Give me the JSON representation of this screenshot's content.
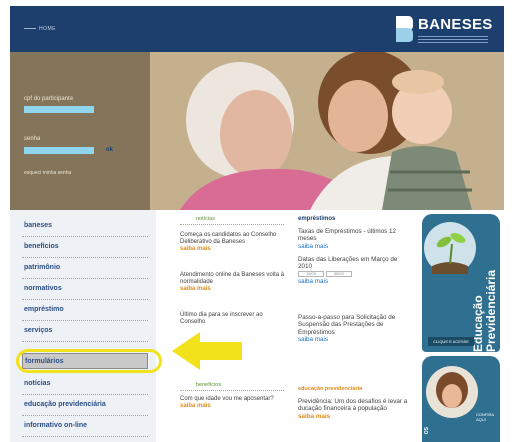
{
  "header": {
    "home_link": "HOME",
    "logo_text": "BANESES"
  },
  "login": {
    "cpf_label": "cpf do participante",
    "password_label": "senha",
    "ok_label": "ok",
    "forgot_label": "esqueci minha senha"
  },
  "nav": {
    "items": [
      "baneses",
      "benefícios",
      "patrimônio",
      "normativos",
      "empréstimo",
      "serviços",
      "formulários",
      "notícias",
      "educação previdenciária",
      "informativo on-line"
    ],
    "highlighted": "formulários"
  },
  "news": {
    "header": "notícias",
    "items": [
      {
        "text": "Começa os candidatos ao Conselho Deliberativo da Baneses",
        "more": "saiba mais"
      },
      {
        "text": "Atendimento online da Baneses volta à normalidade",
        "more": "saiba mais"
      },
      {
        "text": "Último dia para se inscrever ao Conselho",
        "more": ""
      }
    ],
    "benefits_header": "benefícios",
    "benefit_item": {
      "text": "Com que idade vou me aposentar?",
      "more": "saiba mais"
    }
  },
  "loans": {
    "header": "empréstimos",
    "items": [
      {
        "text": "Taxas de Empréstimos - últimos 12 meses",
        "more": "saiba mais"
      },
      {
        "text": "Datas das Liberações em Março de 2010",
        "inputs": [
          "15/03",
          "30/03"
        ],
        "more": "saiba mais"
      },
      {
        "text": "Passo-a-passo para Solicitação de Suspensão das Prestações de Empréstimos",
        "more": "saiba mais"
      }
    ],
    "education_header": "educação previdenciária",
    "education_item": {
      "text": "Previdência: Um dos desafios é levar a ducação financeira à população",
      "more": "saiba mais"
    }
  },
  "banners": {
    "education": {
      "title": "Educação Previdenciária",
      "button": "CLIQUE E ACESSE"
    },
    "second": {
      "side": "OS",
      "text": "CONFIRA AQUI"
    }
  },
  "colors": {
    "brand_blue": "#1c3f6e",
    "nav_text": "#2a4f86",
    "highlight_yellow": "#f2e21b",
    "accent_orange": "#e08a1e",
    "login_input": "#8fd5ee"
  },
  "icons": [
    "baneses-logo-icon",
    "yellow-arrow-icon"
  ]
}
